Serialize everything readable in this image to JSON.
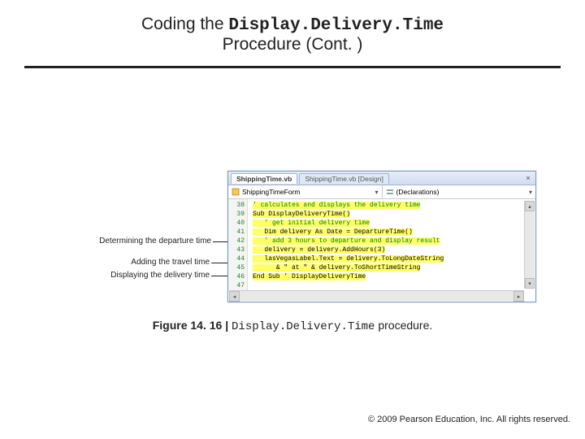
{
  "title": {
    "prefix": "Coding the ",
    "code": "Display.Delivery.Time",
    "line2": "Procedure (Cont. )"
  },
  "annotations": {
    "departure": "Determining the departure time",
    "travel": "Adding the travel time",
    "display": "Displaying the delivery time"
  },
  "window": {
    "tab_active": "ShippingTime.vb",
    "tab_inactive": "ShippingTime.vb [Design]",
    "dd_class": "ShippingTimeForm",
    "dd_member": "(Declarations)"
  },
  "gutter": {
    "l38": "38",
    "l39": "39",
    "l40": "40",
    "l41": "41",
    "l42": "42",
    "l43": "43",
    "l44": "44",
    "l45": "45",
    "l46": "46",
    "l47": "47"
  },
  "code": {
    "l38": "' calculates and displays the delivery time",
    "l39": "Sub DisplayDeliveryTime()",
    "l40": "   ' get initial delivery time",
    "l41": "   Dim delivery As Date = DepartureTime()",
    "l42": "",
    "l43": "   ' add 3 hours to departure and display result",
    "l44": "   delivery = delivery.AddHours(3)",
    "l45": "   lasVegasLabel.Text = delivery.ToLongDateString",
    "l46": "      & \" at \" & delivery.ToShortTimeString",
    "l47": "End Sub ' DisplayDeliveryTime"
  },
  "caption": {
    "figure": "Figure 14. 16",
    "sep": " | ",
    "code": "Display.Delivery.Time",
    "suffix": " procedure."
  },
  "footer": "©  2009 Pearson Education, Inc.  All rights reserved."
}
